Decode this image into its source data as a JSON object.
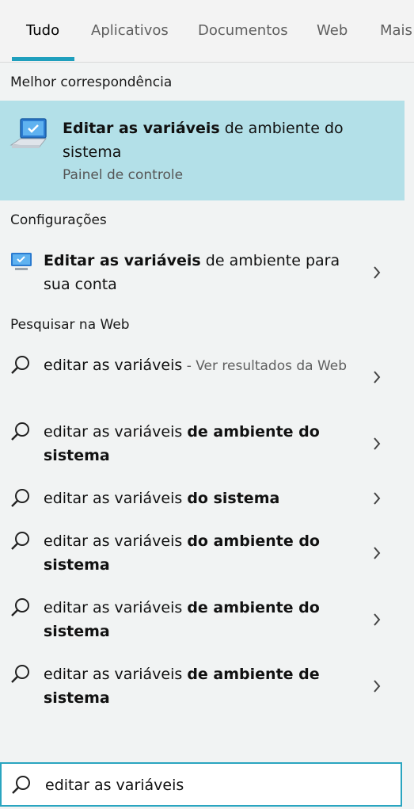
{
  "tabs": [
    "Tudo",
    "Aplicativos",
    "Documentos",
    "Web",
    "Mais"
  ],
  "best_match": {
    "header": "Melhor correspondência",
    "title_bold": "Editar as variáveis",
    "title_rest": " de ambiente do sistema",
    "subtitle": "Painel de controle",
    "icon": "system-properties-icon"
  },
  "settings": {
    "header": "Configurações",
    "item_bold": "Editar as variáveis",
    "item_rest": " de ambiente para sua conta",
    "icon": "monitor-settings-icon"
  },
  "web": {
    "header": "Pesquisar na Web",
    "first": {
      "query": "editar as variáveis",
      "hint": " - Ver resultados da Web"
    },
    "suggestions": [
      {
        "prefix": "editar as variáveis ",
        "bold": "de ambiente do sistema"
      },
      {
        "prefix": "editar as variáveis ",
        "bold": "do sistema"
      },
      {
        "prefix": "editar as variáveis ",
        "bold": "do ambiente do sistema"
      },
      {
        "prefix": "editar as variáveis ",
        "bold": "de ambiente do sistema"
      },
      {
        "prefix": "editar as variáveis ",
        "bold": "de ambiente de sistema"
      }
    ]
  },
  "search": {
    "value": "editar as variáveis"
  },
  "colors": {
    "accent": "#1f9fbd",
    "highlight": "#b3e0e8"
  }
}
